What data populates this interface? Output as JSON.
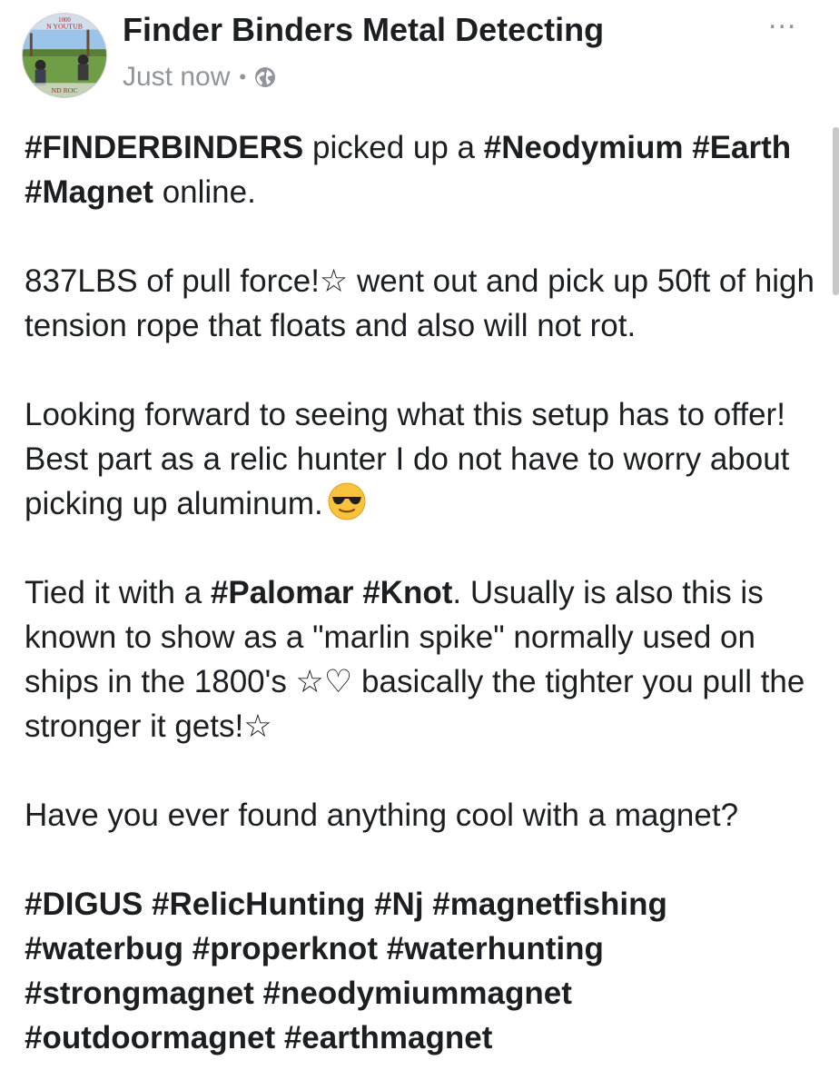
{
  "post": {
    "author": "Finder Binders Metal Detecting",
    "timestamp": "Just now",
    "separator": "•",
    "privacy_icon": "globe-icon",
    "more_label": "...",
    "avatar_text_top": "1000",
    "avatar_text_mid": "N YOUTUB",
    "avatar_text_bottom": "ND ROC",
    "paragraphs": [
      [
        {
          "t": "#FINDERBINDERS",
          "b": true
        },
        {
          "t": " picked up a "
        },
        {
          "t": "#Neodymium",
          "b": true
        },
        {
          "t": " "
        },
        {
          "t": "#Earth",
          "b": true
        },
        {
          "t": " "
        },
        {
          "t": "#Magnet",
          "b": true
        },
        {
          "t": " online."
        }
      ],
      [
        {
          "t": "837LBS of pull force!☆ went out and pick up 50ft of high tension rope that floats and also will not rot."
        }
      ],
      [
        {
          "t": "Looking forward to seeing what this setup has to offer! Best part as a relic hunter I do not have to worry about picking up aluminum."
        },
        {
          "emoji": "smiling-face-with-sunglasses-icon"
        }
      ],
      [
        {
          "t": "Tied it with a "
        },
        {
          "t": "#Palomar",
          "b": true
        },
        {
          "t": " "
        },
        {
          "t": "#Knot",
          "b": true
        },
        {
          "t": ". Usually is also this is known to show as a \"marlin spike\" normally used on ships in the 1800's ☆♡ basically the tighter you pull the stronger it gets!☆"
        }
      ],
      [
        {
          "t": "Have you ever found anything cool with a magnet?"
        }
      ],
      [
        {
          "t": "#DIGUS",
          "b": true
        },
        {
          "t": " "
        },
        {
          "t": "#RelicHunting",
          "b": true
        },
        {
          "t": " "
        },
        {
          "t": "#Nj",
          "b": true
        },
        {
          "t": " "
        },
        {
          "t": "#magnetfishing",
          "b": true
        },
        {
          "t": " "
        },
        {
          "t": "#waterbug",
          "b": true
        },
        {
          "t": " "
        },
        {
          "t": "#properknot",
          "b": true
        },
        {
          "t": " "
        },
        {
          "t": "#waterhunting",
          "b": true
        },
        {
          "t": " "
        },
        {
          "t": "#strongmagnet",
          "b": true
        },
        {
          "t": " "
        },
        {
          "t": "#neodymiummagnet",
          "b": true
        },
        {
          "t": " "
        },
        {
          "t": "#outdoormagnet",
          "b": true
        },
        {
          "t": " "
        },
        {
          "t": "#earthmagnet",
          "b": true
        }
      ]
    ]
  },
  "colors": {
    "text": "#1c1e21",
    "meta": "#90949c",
    "background": "#ffffff"
  }
}
